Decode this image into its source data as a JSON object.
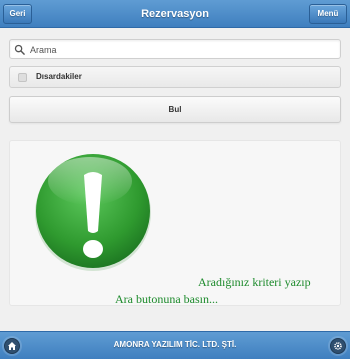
{
  "header": {
    "title": "Rezervasyon",
    "back_label": "Geri",
    "menu_label": "Menü"
  },
  "search": {
    "placeholder": "Arama",
    "value": "",
    "icon": "search-icon"
  },
  "filter": {
    "checkbox_label": "Dısardakiler",
    "checked": false
  },
  "find_button": {
    "label": "Bul"
  },
  "empty_state": {
    "icon": "alert-exclamation-icon",
    "line1": "Aradığınız kriteri yazıp",
    "line2": "Ara butonuna basın..."
  },
  "footer": {
    "company": "AMONRA YAZILIM TİC. LTD. ŞTİ.",
    "left_icon": "home-icon",
    "right_icon": "gear-icon"
  },
  "colors": {
    "header_bar": "#4a8bc8",
    "alert_green": "#3aa33a",
    "message_green": "#1c8a2b"
  }
}
